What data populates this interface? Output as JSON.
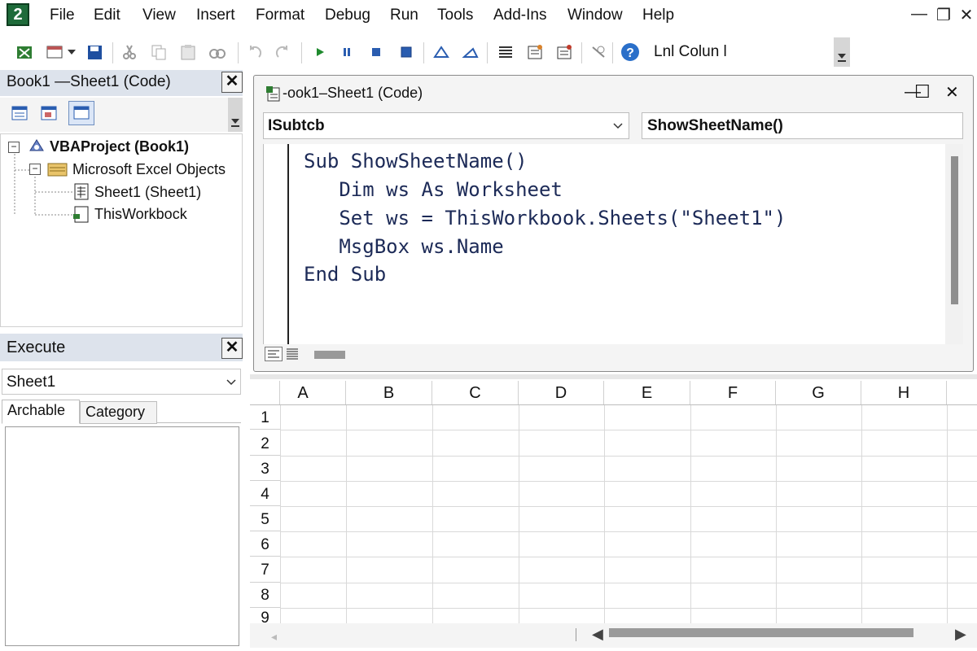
{
  "app_icon_text": "2",
  "menu": [
    "File",
    "Edit",
    "View",
    "Insert",
    "Format",
    "Debug",
    "Run",
    "Tools",
    "Add-Ins",
    "Window",
    "Help"
  ],
  "window_controls": {
    "minimize": "—",
    "restore": "❐",
    "close": "✕"
  },
  "toolbar": {
    "status_text": "Lnl Colun l",
    "icons": [
      "excel-icon",
      "insert-form-icon",
      "save-icon",
      "cut-icon",
      "copy-icon",
      "paste-icon",
      "find-icon",
      "undo-icon",
      "redo-icon",
      "run-icon",
      "break-icon",
      "reset-icon",
      "design-mode-icon",
      "project-explorer-icon",
      "properties-icon",
      "object-browser-icon",
      "toolbox-icon",
      "debug-icon",
      "help-icon"
    ]
  },
  "project_pane": {
    "title": "Book1 —Sheet1 (Code)",
    "close": "✕",
    "tree": {
      "root": "VBAProject (Book1)",
      "folder": "Microsoft Excel Objects",
      "items": [
        "Sheet1 (Sheet1)",
        "ThisWorkbock"
      ]
    }
  },
  "execute_pane": {
    "title": "Execute",
    "close": "✕",
    "selected": "Sheet1",
    "tabs": [
      "Archable",
      "Category"
    ]
  },
  "code_window": {
    "title": "-ook1–Sheet1 (Code)",
    "controls": {
      "minimize": "—",
      "maximize": "☐",
      "close": "✕"
    },
    "object_combo": "ISubtcb",
    "procedure_combo": "ShowSheetName()",
    "code_lines": [
      "Sub ShowSheetName()",
      "   Dim ws As Worksheet",
      "   Set ws = ThisWorkbook.Sheets(\"Sheet1\")",
      "   MsgBox ws.Name",
      "End Sub"
    ]
  },
  "sheet": {
    "columns": [
      "A",
      "B",
      "C",
      "D",
      "E",
      "F",
      "G",
      "H"
    ],
    "rows": [
      "1",
      "2",
      "3",
      "4",
      "5",
      "6",
      "7",
      "8",
      "9"
    ]
  }
}
